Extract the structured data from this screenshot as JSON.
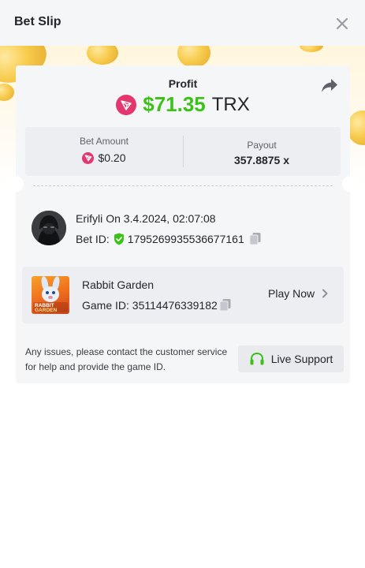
{
  "header": {
    "title": "Bet Slip"
  },
  "profit": {
    "label": "Profit",
    "value": "$71.35",
    "currency": "TRX"
  },
  "stats": {
    "bet_amount_label": "Bet Amount",
    "bet_amount_value": "$0.20",
    "payout_label": "Payout",
    "payout_value": "357.8875 x"
  },
  "user": {
    "name": "Erifyli",
    "date": "On 3.4.2024, 02:07:08",
    "bet_id_label": "Bet ID:",
    "bet_id": "1795269935536677161"
  },
  "game": {
    "name": "Rabbit Garden",
    "thumb_text": "RABBIT GARDEN",
    "game_id_label": "Game ID:",
    "game_id": "35114476339182",
    "play_now_label": "Play Now"
  },
  "support": {
    "issue_text": "Any issues, please contact the customer service for help and provide the game ID.",
    "live_support_label": "Live Support"
  },
  "icons": {
    "close": "close-icon",
    "share": "share-icon",
    "trx_currency": "trx-icon",
    "verified": "shield-check-icon",
    "copy": "copy-icon",
    "chevron": "chevron-right-icon",
    "headset": "headset-icon"
  },
  "colors": {
    "profit_green": "#3bc117",
    "trx_red": "#e2386f",
    "verified_green": "#3bc117",
    "card_bg": "#f5f6f8"
  }
}
